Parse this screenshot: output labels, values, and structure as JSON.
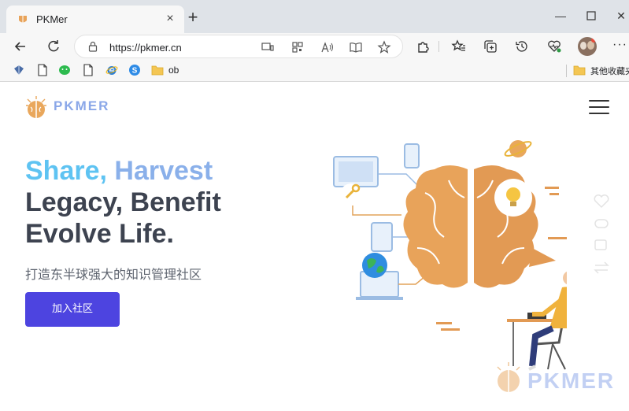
{
  "browser": {
    "tab": {
      "title": "PKMer",
      "favicon": "pkmer-icon"
    },
    "address_bar": {
      "url": "https://pkmer.cn"
    },
    "window_controls": [
      "minimize-icon",
      "maximize-icon",
      "close-icon"
    ],
    "bookmarks": [
      {
        "icon": "app-icon",
        "label": ""
      },
      {
        "icon": "file-icon",
        "label": ""
      },
      {
        "icon": "wechat-icon",
        "label": ""
      },
      {
        "icon": "file-icon",
        "label": ""
      },
      {
        "icon": "ie-icon",
        "label": ""
      },
      {
        "icon": "s-icon",
        "label": ""
      },
      {
        "icon": "folder-icon",
        "label": "ob"
      }
    ],
    "other_bookmarks": "其他收藏夹"
  },
  "page": {
    "logo_text": "PKMER",
    "hero": {
      "line1_a": "Share, ",
      "line1_b": "Harvest",
      "line2": "Legacy, Benefit",
      "line3": "Evolve Life."
    },
    "subtitle": "打造东半球强大的知识管理社区",
    "join_button": "加入社区",
    "watermark": "PKMER"
  },
  "colors": {
    "accent": "#4d44e0",
    "hero_blue": "#5ec3f2",
    "hero_lavender": "#8ab0ea",
    "heading_dark": "#3d4350",
    "brain_orange": "#e8a35a"
  }
}
